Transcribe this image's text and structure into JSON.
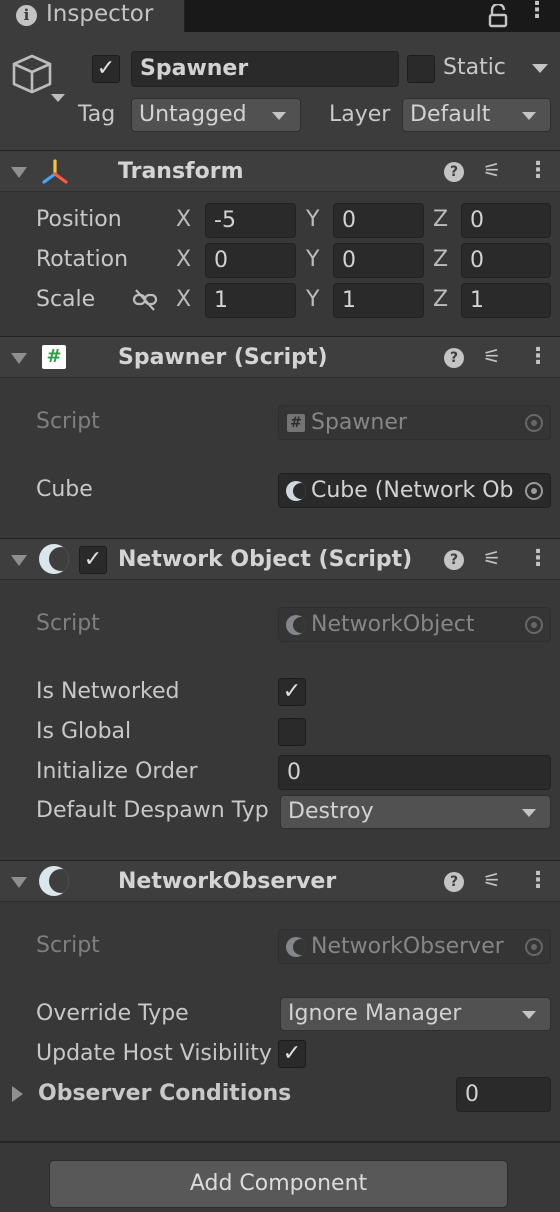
{
  "window": {
    "tab_label": "Inspector"
  },
  "gameobject": {
    "active": true,
    "name": "Spawner",
    "static_label": "Static",
    "tag_label": "Tag",
    "tag_value": "Untagged",
    "layer_label": "Layer",
    "layer_value": "Default"
  },
  "transform": {
    "title": "Transform",
    "position_label": "Position",
    "rotation_label": "Rotation",
    "scale_label": "Scale",
    "axis_x": "X",
    "axis_y": "Y",
    "axis_z": "Z",
    "position": {
      "x": "-5",
      "y": "0",
      "z": "0"
    },
    "rotation": {
      "x": "0",
      "y": "0",
      "z": "0"
    },
    "scale": {
      "x": "1",
      "y": "1",
      "z": "1"
    }
  },
  "spawner_script": {
    "title": "Spawner (Script)",
    "script_label": "Script",
    "script_value": "Spawner",
    "cube_label": "Cube",
    "cube_value": "Cube (Network Ob"
  },
  "network_object": {
    "enabled": true,
    "title": "Network Object (Script)",
    "script_label": "Script",
    "script_value": "NetworkObject",
    "is_networked_label": "Is Networked",
    "is_networked": true,
    "is_global_label": "Is Global",
    "is_global": false,
    "initialize_order_label": "Initialize Order",
    "initialize_order": "0",
    "despawn_label": "Default Despawn Typ",
    "despawn_value": "Destroy"
  },
  "network_observer": {
    "title": "NetworkObserver",
    "script_label": "Script",
    "script_value": "NetworkObserver",
    "override_type_label": "Override Type",
    "override_type_value": "Ignore Manager",
    "update_host_label": "Update Host Visibility",
    "update_host": true,
    "observer_conditions_label": "Observer Conditions",
    "observer_conditions_count": "0"
  },
  "footer": {
    "add_component_label": "Add Component"
  },
  "colors": {
    "background": "#383838",
    "header_bg": "#3e3e3e",
    "field_bg": "#2a2a2a",
    "tab_bar": "#191919"
  }
}
